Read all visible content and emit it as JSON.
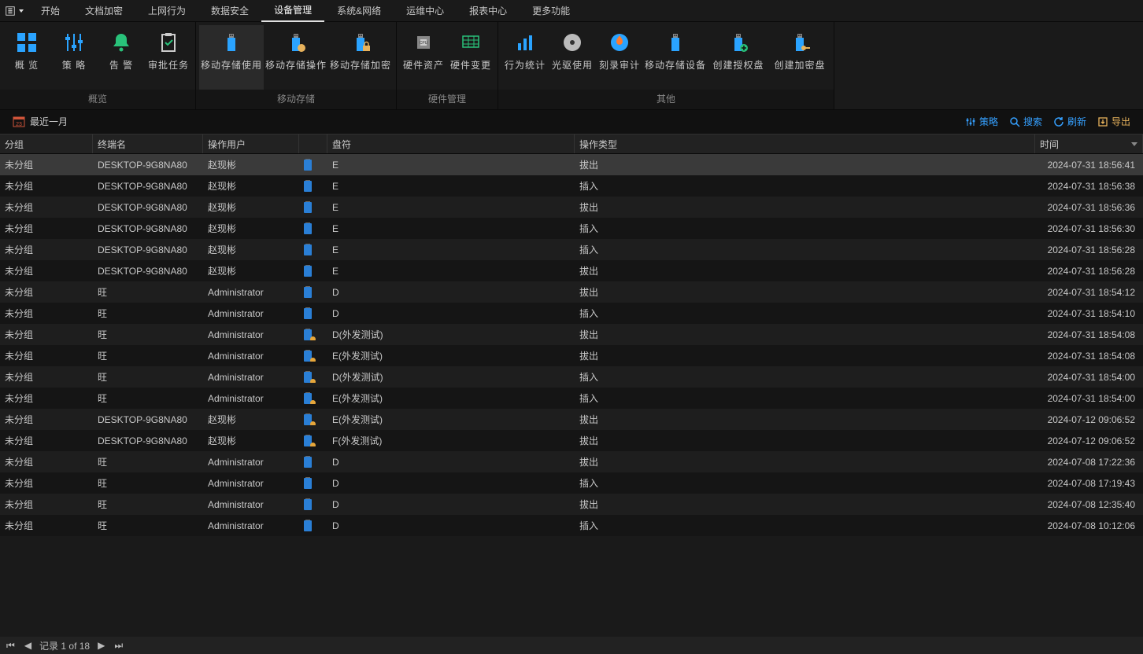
{
  "menu": [
    "开始",
    "文档加密",
    "上网行为",
    "数据安全",
    "设备管理",
    "系统&网络",
    "运维中心",
    "报表中心",
    "更多功能"
  ],
  "active_menu_index": 4,
  "ribbon": {
    "groups": [
      {
        "label": "概览",
        "items": [
          {
            "label": "概  览",
            "icon": "overview",
            "sel": false
          },
          {
            "label": "策  略",
            "icon": "sliders",
            "sel": false
          },
          {
            "label": "告  警",
            "icon": "bell",
            "sel": false
          },
          {
            "label": "审批任务",
            "icon": "clipboard",
            "sel": false
          }
        ]
      },
      {
        "label": "移动存储",
        "items": [
          {
            "label": "移动存储使用",
            "icon": "usb",
            "sel": true,
            "w": "wider"
          },
          {
            "label": "移动存储操作",
            "icon": "usb-gear",
            "sel": false,
            "w": "wider"
          },
          {
            "label": "移动存储加密",
            "icon": "usb-lock",
            "sel": false,
            "w": "wider"
          }
        ]
      },
      {
        "label": "硬件管理",
        "items": [
          {
            "label": "硬件资产",
            "icon": "cpu",
            "sel": false
          },
          {
            "label": "硬件变更",
            "icon": "grid",
            "sel": false
          }
        ]
      },
      {
        "label": "其他",
        "items": [
          {
            "label": "行为统计",
            "icon": "chart",
            "sel": false
          },
          {
            "label": "光驱使用",
            "icon": "disc",
            "sel": false
          },
          {
            "label": "刻录审计",
            "icon": "disc-fire",
            "sel": false
          },
          {
            "label": "移动存储设备",
            "icon": "usb",
            "sel": false,
            "w": "wider"
          },
          {
            "label": "创建授权盘",
            "icon": "usb-plus",
            "sel": false,
            "w": "wide"
          },
          {
            "label": "创建加密盘",
            "icon": "usb-key",
            "sel": false,
            "w": "wide"
          }
        ]
      }
    ]
  },
  "toolbar": {
    "date_range": "最近一月",
    "actions": [
      {
        "label": "策略",
        "icon": "sliders",
        "name": "policy-button"
      },
      {
        "label": "搜索",
        "icon": "search",
        "name": "search-button"
      },
      {
        "label": "刷新",
        "icon": "refresh",
        "name": "refresh-button"
      },
      {
        "label": "导出",
        "icon": "export",
        "name": "export-button"
      }
    ]
  },
  "columns": [
    "分组",
    "终端名",
    "操作用户",
    "",
    "盘符",
    "操作类型",
    "时间"
  ],
  "rows": [
    {
      "g": "未分组",
      "t": "DESKTOP-9G8NA80",
      "u": "赵现彬",
      "ic": "usb",
      "d": "E",
      "op": "拔出",
      "tm": "2024-07-31 18:56:41",
      "sel": true
    },
    {
      "g": "未分组",
      "t": "DESKTOP-9G8NA80",
      "u": "赵现彬",
      "ic": "usb",
      "d": "E",
      "op": "插入",
      "tm": "2024-07-31 18:56:38"
    },
    {
      "g": "未分组",
      "t": "DESKTOP-9G8NA80",
      "u": "赵现彬",
      "ic": "usb",
      "d": "E",
      "op": "拔出",
      "tm": "2024-07-31 18:56:36"
    },
    {
      "g": "未分组",
      "t": "DESKTOP-9G8NA80",
      "u": "赵现彬",
      "ic": "usb",
      "d": "E",
      "op": "插入",
      "tm": "2024-07-31 18:56:30"
    },
    {
      "g": "未分组",
      "t": "DESKTOP-9G8NA80",
      "u": "赵现彬",
      "ic": "usb",
      "d": "E",
      "op": "插入",
      "tm": "2024-07-31 18:56:28"
    },
    {
      "g": "未分组",
      "t": "DESKTOP-9G8NA80",
      "u": "赵现彬",
      "ic": "usb",
      "d": "E",
      "op": "拔出",
      "tm": "2024-07-31 18:56:28"
    },
    {
      "g": "未分组",
      "t": "旺",
      "u": "Administrator",
      "ic": "usb",
      "d": "D",
      "op": "拔出",
      "tm": "2024-07-31 18:54:12"
    },
    {
      "g": "未分组",
      "t": "旺",
      "u": "Administrator",
      "ic": "usb",
      "d": "D",
      "op": "插入",
      "tm": "2024-07-31 18:54:10"
    },
    {
      "g": "未分组",
      "t": "旺",
      "u": "Administrator",
      "ic": "usb-lock",
      "d": "D(外发测试)",
      "op": "拔出",
      "tm": "2024-07-31 18:54:08"
    },
    {
      "g": "未分组",
      "t": "旺",
      "u": "Administrator",
      "ic": "usb-lock",
      "d": "E(外发测试)",
      "op": "拔出",
      "tm": "2024-07-31 18:54:08"
    },
    {
      "g": "未分组",
      "t": "旺",
      "u": "Administrator",
      "ic": "usb-lock",
      "d": "D(外发测试)",
      "op": "插入",
      "tm": "2024-07-31 18:54:00"
    },
    {
      "g": "未分组",
      "t": "旺",
      "u": "Administrator",
      "ic": "usb-lock",
      "d": "E(外发测试)",
      "op": "插入",
      "tm": "2024-07-31 18:54:00"
    },
    {
      "g": "未分组",
      "t": "DESKTOP-9G8NA80",
      "u": "赵现彬",
      "ic": "usb-lock",
      "d": "E(外发测试)",
      "op": "拔出",
      "tm": "2024-07-12 09:06:52"
    },
    {
      "g": "未分组",
      "t": "DESKTOP-9G8NA80",
      "u": "赵现彬",
      "ic": "usb-lock",
      "d": "F(外发测试)",
      "op": "拔出",
      "tm": "2024-07-12 09:06:52"
    },
    {
      "g": "未分组",
      "t": "旺",
      "u": "Administrator",
      "ic": "usb",
      "d": "D",
      "op": "拔出",
      "tm": "2024-07-08 17:22:36"
    },
    {
      "g": "未分组",
      "t": "旺",
      "u": "Administrator",
      "ic": "usb",
      "d": "D",
      "op": "插入",
      "tm": "2024-07-08 17:19:43"
    },
    {
      "g": "未分组",
      "t": "旺",
      "u": "Administrator",
      "ic": "usb",
      "d": "D",
      "op": "拔出",
      "tm": "2024-07-08 12:35:40"
    },
    {
      "g": "未分组",
      "t": "旺",
      "u": "Administrator",
      "ic": "usb",
      "d": "D",
      "op": "插入",
      "tm": "2024-07-08 10:12:06"
    }
  ],
  "status": {
    "record_text": "记录 1 of 18"
  }
}
